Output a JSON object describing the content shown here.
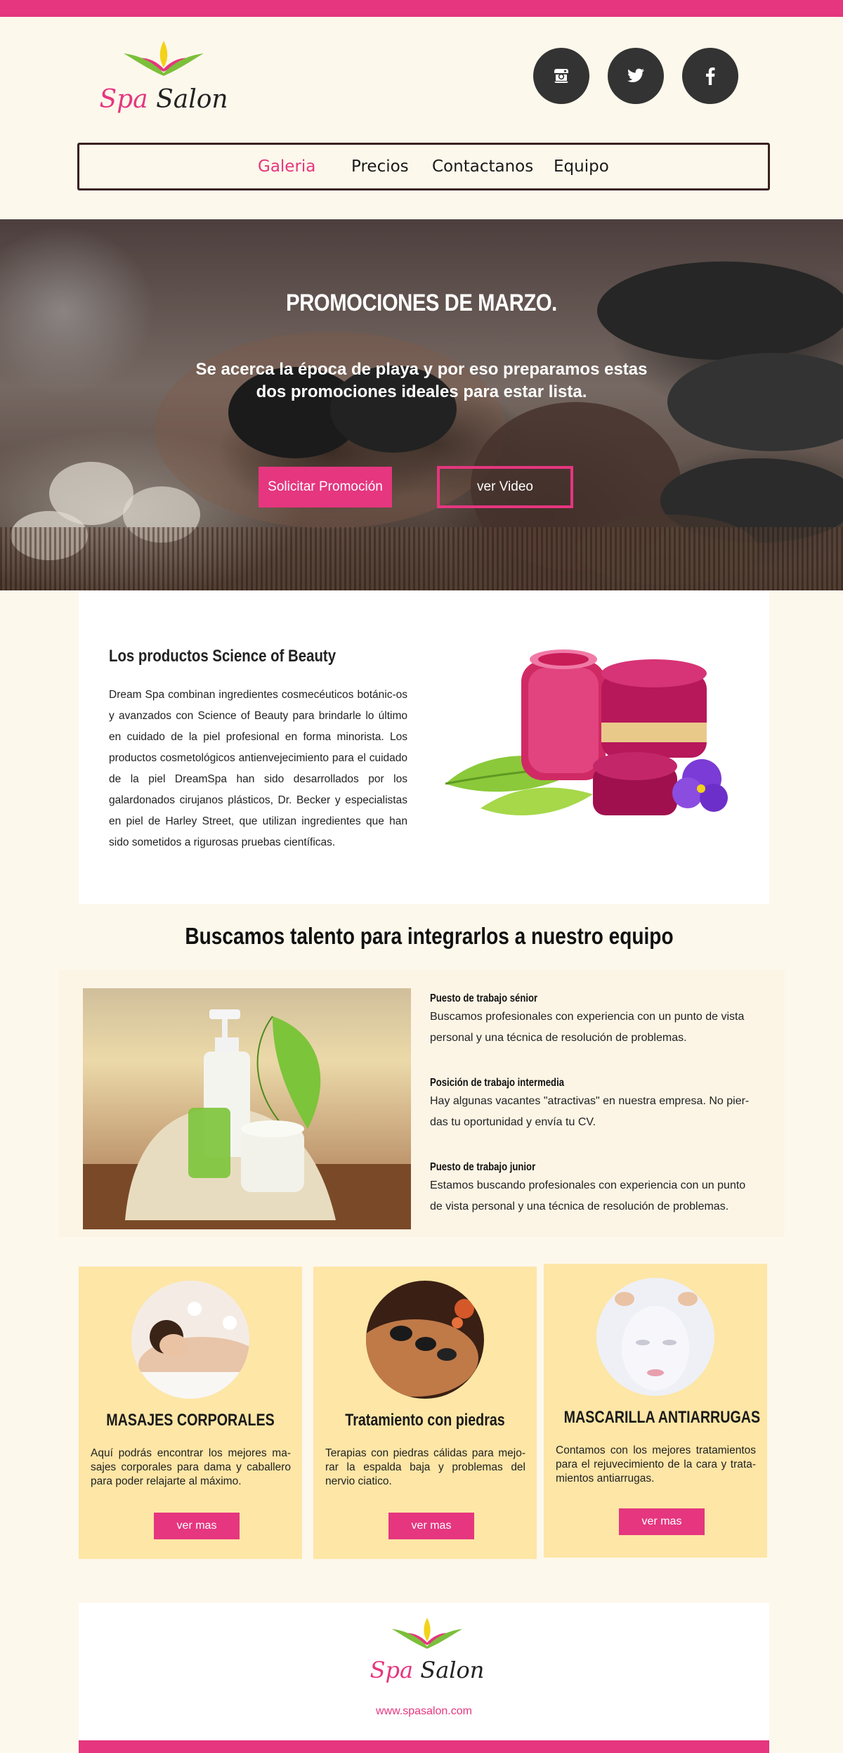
{
  "colors": {
    "accent": "#e5367f",
    "card_bg": "#fde6a6",
    "page_bg": "#fdf8ec",
    "dark": "#333333"
  },
  "logo": {
    "word1": "Spa",
    "word2": "Salon"
  },
  "social": [
    {
      "icon": "instagram-icon",
      "glyph": "◙"
    },
    {
      "icon": "twitter-icon",
      "glyph": "🐦"
    },
    {
      "icon": "facebook-icon",
      "glyph": "f"
    }
  ],
  "nav": {
    "items": [
      "Galeria",
      "Precios",
      "Contactanos",
      "Equipo"
    ],
    "active": "Galeria"
  },
  "hero": {
    "title": "PROMOCIONES DE MARZO.",
    "subtitle": "Se acerca la época de playa y por eso preparamos estas dos promociones ideales para estar lista.",
    "primary_button": "Solicitar Promoción",
    "secondary_button": "ver Video"
  },
  "products": {
    "title": "Los productos Science of Beauty",
    "text": "Dream Spa combinan ingredientes cosmecéuticos botánic-os y avanzados con Science of Beauty para brindarle lo último en cuidado de la piel profesional en forma minorista. Los productos cosmetológicos antienvejecimiento para el cuidado de la piel DreamSpa han sido desarrollados por los galardonados cirujanos plásticos, Dr. Becker y especialistas en piel de Harley Street, que utilizan ingredientes que han sido sometidos a rigurosas pruebas científicas."
  },
  "jobs": {
    "title": "Buscamos talento para integrarlos a nuestro equipo",
    "items": [
      {
        "title": "Puesto de trabajo sénior",
        "text": "Buscamos profesionales con experiencia con un punto de vista personal y una técnica de resolución de problemas."
      },
      {
        "title": "Posición de trabajo intermedia",
        "text": "Hay algunas vacantes \"atractivas\" en nuestra empresa. No pier-das tu oportunidad y envía tu CV."
      },
      {
        "title": "Puesto de trabajo junior",
        "text": "Estamos buscando profesionales con experiencia con un punto de vista personal y una técnica de resolución de problemas."
      }
    ]
  },
  "cards": [
    {
      "title": "MASAJES CORPORALES",
      "text": "Aquí podrás encontrar los mejores ma-sajes corporales para dama y caballero para poder relajarte al máximo.",
      "button": "ver mas"
    },
    {
      "title": "Tratamiento con piedras",
      "text": "Terapias con piedras cálidas para mejo-rar la espalda baja y problemas del nervio ciatico.",
      "button": "ver mas"
    },
    {
      "title": "MASCARILLA ANTIARRUGAS",
      "text": "Contamos con los mejores tratamientos para el rejuvecimiento de la cara y trata-mientos antiarrugas.",
      "button": "ver mas"
    }
  ],
  "footer": {
    "url": "www.spasalon.com"
  }
}
